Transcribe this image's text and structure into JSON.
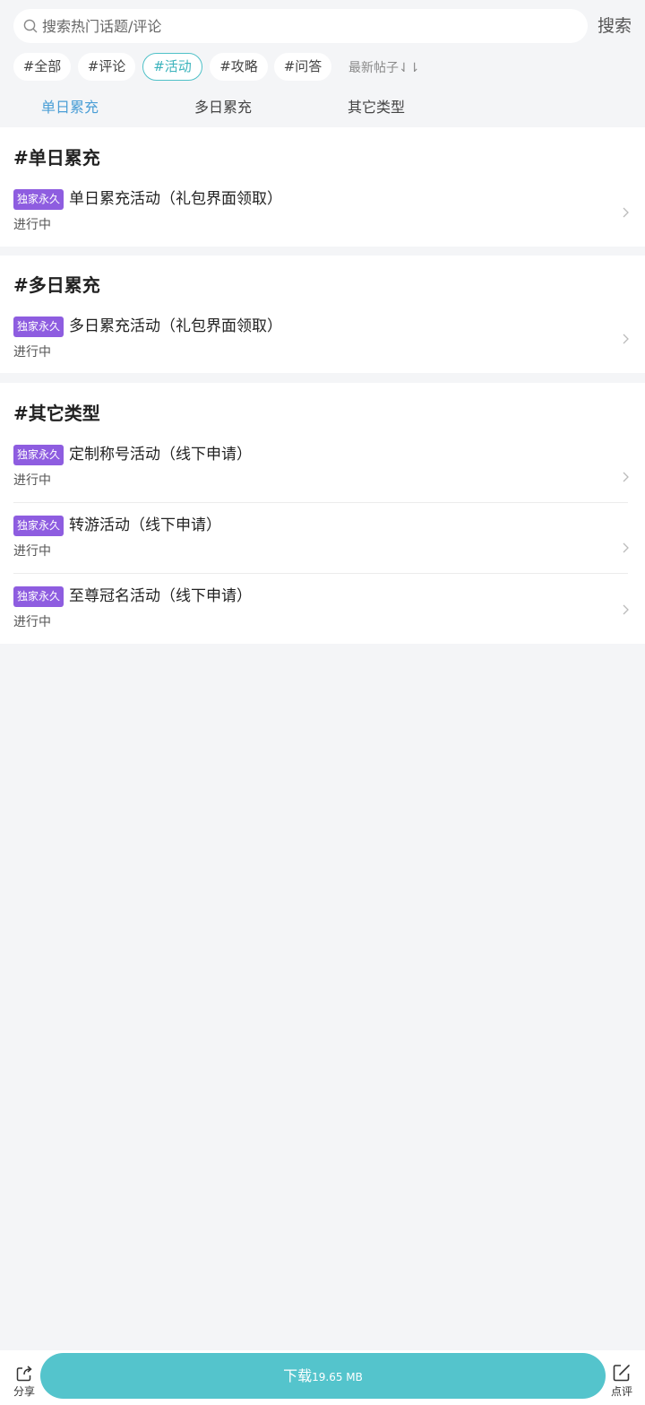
{
  "search": {
    "placeholder": "搜索热门话题/评论",
    "button_label": "搜索"
  },
  "chips": [
    {
      "label": "#全部",
      "active": false
    },
    {
      "label": "#评论",
      "active": false
    },
    {
      "label": "#活动",
      "active": true
    },
    {
      "label": "#攻略",
      "active": false
    },
    {
      "label": "#问答",
      "active": false
    }
  ],
  "sort": {
    "label": "最新帖子⇃⇂"
  },
  "tabs": [
    {
      "label": "单日累充",
      "active": true
    },
    {
      "label": "多日累充",
      "active": false
    },
    {
      "label": "其它类型",
      "active": false
    }
  ],
  "sections": [
    {
      "title": "#单日累充",
      "items": [
        {
          "badge": "独家永久",
          "title": "单日累充活动（礼包界面领取）",
          "status": "进行中"
        }
      ]
    },
    {
      "title": "#多日累充",
      "items": [
        {
          "badge": "独家永久",
          "title": "多日累充活动（礼包界面领取）",
          "status": "进行中"
        }
      ]
    },
    {
      "title": "#其它类型",
      "items": [
        {
          "badge": "独家永久",
          "title": "定制称号活动（线下申请）",
          "status": "进行中"
        },
        {
          "badge": "独家永久",
          "title": "转游活动（线下申请）",
          "status": "进行中"
        },
        {
          "badge": "独家永久",
          "title": "至尊冠名活动（线下申请）",
          "status": "进行中"
        }
      ]
    }
  ],
  "bottom": {
    "share_label": "分享",
    "download_label": "下载",
    "download_size": "19.65 MB",
    "review_label": "点评"
  },
  "colors": {
    "accent": "#4fc1c8",
    "tab_active": "#4a9ed6",
    "badge": "#8e5de0",
    "download_button": "#54c4cc",
    "background": "#f4f5f7"
  }
}
